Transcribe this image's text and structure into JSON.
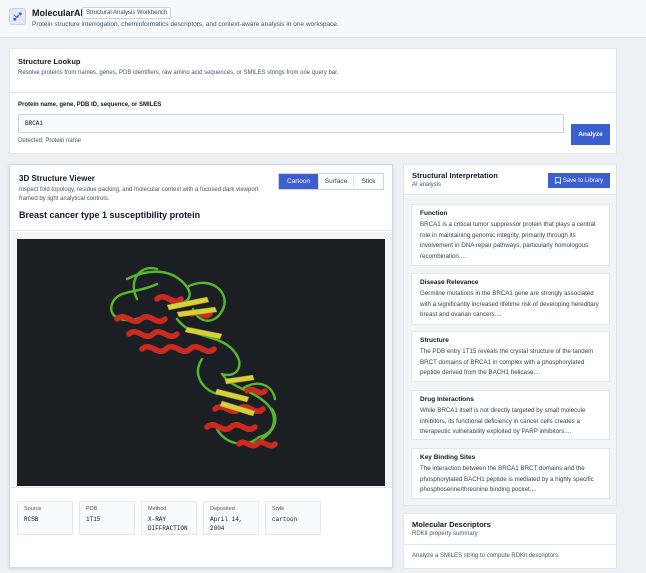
{
  "app": {
    "name": "MolecularAI",
    "badge": "Structural Analysis Workbench",
    "subtitle": "Protein structure interrogation, cheminformatics descriptors, and context-aware analysis in one workspace.",
    "logo_icon": "molecule-icon"
  },
  "lookup": {
    "title": "Structure Lookup",
    "description": "Resolve proteins from names, genes, PDB identifiers, raw amino acid sequences, or SMILES strings from one query bar.",
    "input_label": "Protein name, gene, PDB ID, sequence, or SMILES",
    "input_value": "BRCA1",
    "detected": "Detected: Protein name",
    "analyze_label": "Analyze"
  },
  "viewer": {
    "title": "3D Structure Viewer",
    "description": "Inspect fold topology, residue packing, and molecular context with a focused dark viewport framed by light analytical controls.",
    "protein_name": "Breast cancer type 1 susceptibility protein",
    "styles": [
      "Cartoon",
      "Surface",
      "Stick"
    ],
    "active_style": "Cartoon",
    "metadata": [
      {
        "key": "Source",
        "value": "RCSB"
      },
      {
        "key": "PDB",
        "value": "1T15"
      },
      {
        "key": "Method",
        "value": "X-RAY DIFFRACTION"
      },
      {
        "key": "Deposited",
        "value": "April 14, 2004"
      },
      {
        "key": "Style",
        "value": "cartoon"
      }
    ]
  },
  "interpretation": {
    "title": "Structural Interpretation",
    "subtitle": "AI analysis",
    "save_label": "Save to Library",
    "save_icon": "bookmark-icon",
    "cards": [
      {
        "title": "Function",
        "text": "BRCA1 is a critical tumor suppressor protein that plays a central role in maintaining genomic integrity, primarily through its involvement in DNA repair pathways, particularly homologous recombination...."
      },
      {
        "title": "Disease Relevance",
        "text": "Germline mutations in the BRCA1 gene are strongly associated with a significantly increased lifetime risk of developing hereditary breast and ovarian cancers...."
      },
      {
        "title": "Structure",
        "text": "The PDB entry 1T15 reveals the crystal structure of the tandem BRCT domains of BRCA1 in complex with a phosphorylated peptide derived from the BACH1 helicase...."
      },
      {
        "title": "Drug Interactions",
        "text": "While BRCA1 itself is not directly targeted by small molecule inhibitors, its functional deficiency in cancer cells creates a therapeutic vulnerability exploited by PARP inhibitors...."
      },
      {
        "title": "Key Binding Sites",
        "text": "The interaction between the BRCA1 BRCT domains and the phosphorylated BACH1 peptide is mediated by a highly specific phosphoserine/threonine binding pocket...."
      }
    ]
  },
  "descriptors": {
    "title": "Molecular Descriptors",
    "subtitle": "RDKit property summary",
    "empty_text": "Analyze a SMILES string to compute RDKit descriptors."
  },
  "colors": {
    "accent": "#3b5fd0",
    "viewport": "#1b1f24",
    "helix": "#cc2a1e",
    "strand": "#d9cf3b",
    "coil": "#56b82c"
  }
}
